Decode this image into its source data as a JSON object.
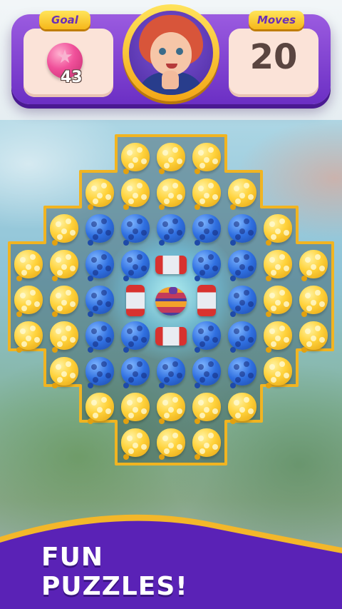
{
  "hud": {
    "goal_label": "Goal",
    "goal_item_icon": "pink-star-ball-icon",
    "goal_count": "43",
    "moves_label": "Moves",
    "moves_count": "20",
    "avatar": "red-haired-girl-avatar"
  },
  "board": {
    "legend": {
      "Y": "yellow-balloon",
      "B": "blue-balloon",
      "RH": "horizontal-rocket",
      "RV": "vertical-rocket",
      "BM": "bomb"
    },
    "rows": [
      "..YYY..",
      ".YYYYY.",
      "YBBBBBY",
      "YYBB,RH,BBYY",
      "YYB,RV,BM,RV,BYY",
      "YYBB,RH,BBYY",
      ".YBBBBBY.",
      ".YYYYY.",
      "..YYY.."
    ]
  },
  "banner": {
    "line1": "FUN",
    "line2": "PUZZLES!"
  },
  "colors": {
    "hud_purple": "#7b3fd2",
    "tag_yellow": "#ffd43b",
    "banner_purple": "#5a22b6",
    "gold_border": "#f1b421"
  }
}
